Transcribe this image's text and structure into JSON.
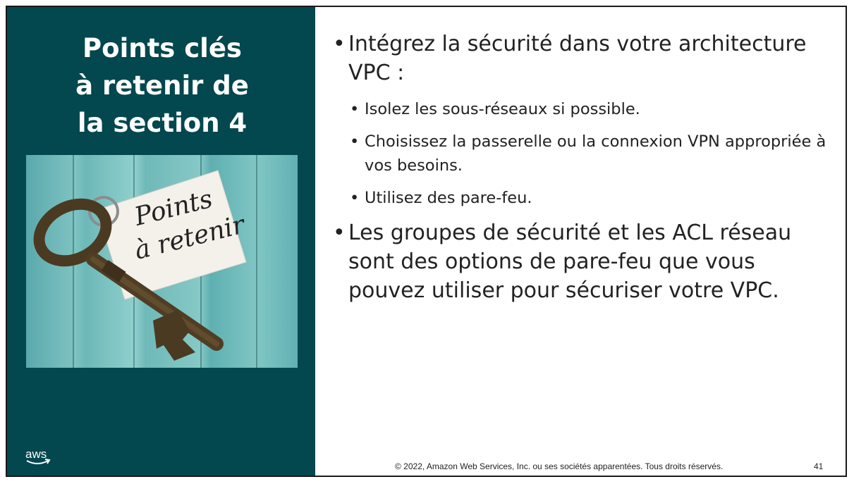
{
  "slide": {
    "title": "Points clés\nà retenir de\nla section 4",
    "image": {
      "alt": "key-with-tag-photo",
      "tag_line1": "Points",
      "tag_line2": "à retenir"
    },
    "bullets": [
      {
        "text": "Intégrez la sécurité dans votre architecture VPC :",
        "sub": [
          "Isolez les sous-réseaux si possible.",
          "Choisissez la passerelle ou la connexion VPN appropriée à vos besoins.",
          "Utilisez des pare-feu."
        ]
      },
      {
        "text": "Les groupes de sécurité et les ACL réseau sont des options de pare-feu que vous pouvez utiliser pour sécuriser votre VPC."
      }
    ],
    "logo": "aws",
    "footer": "© 2022, Amazon Web Services, Inc. ou ses sociétés apparentées. Tous droits réservés.",
    "page_number": "41"
  },
  "colors": {
    "panel": "#03474f",
    "text": "#222222",
    "title": "#ffffff",
    "logo_smile": "#ffffff"
  }
}
